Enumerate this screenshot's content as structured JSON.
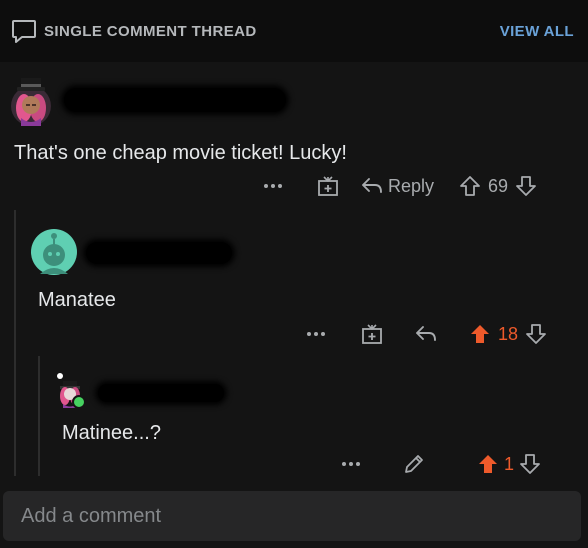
{
  "header": {
    "title": "SINGLE COMMENT THREAD",
    "view_all": "VIEW ALL"
  },
  "comments": [
    {
      "text": "That's one cheap movie ticket! Lucky!",
      "reply_label": "Reply",
      "votes": "69",
      "upvoted": false
    },
    {
      "text": "Manatee",
      "votes": "18",
      "upvoted": true
    },
    {
      "text": "Matinee...?",
      "votes": "1",
      "upvoted": true
    }
  ],
  "composer": {
    "placeholder": "Add a comment"
  },
  "colors": {
    "upvote": "#ee5a2b",
    "link": "#6aa2d8",
    "background": "#141414"
  },
  "icons": {
    "header": "chat-bubble-icon",
    "more": "more-dots-icon",
    "award": "award-gift-icon",
    "reply": "reply-arrow-icon",
    "upvote": "upvote-arrow-icon",
    "downvote": "downvote-arrow-icon",
    "edit": "pencil-edit-icon"
  }
}
